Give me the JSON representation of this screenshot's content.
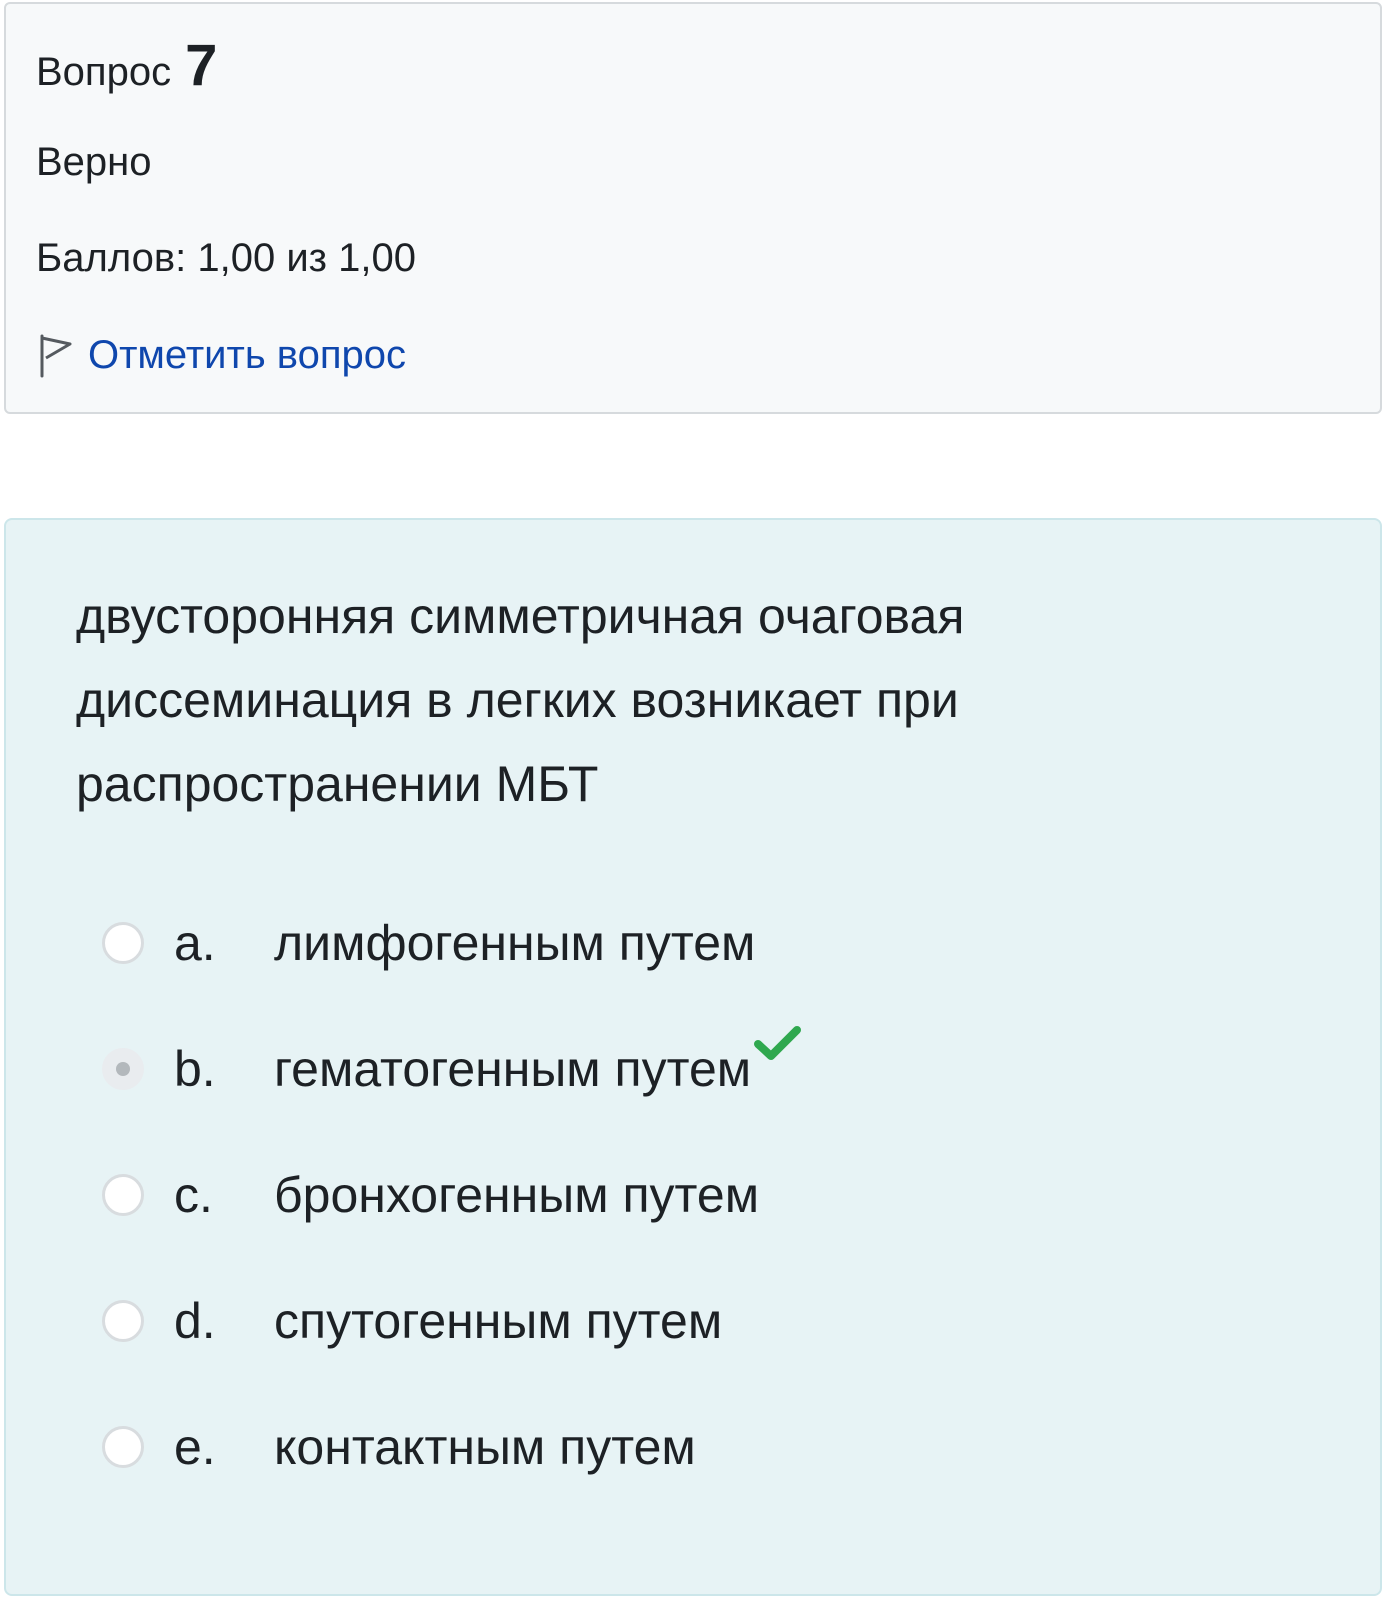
{
  "question_info": {
    "question_word": "Вопрос",
    "question_number": "7",
    "state": "Верно",
    "grade": "Баллов: 1,00 из 1,00",
    "flag_label": "Отметить вопрос"
  },
  "question": {
    "text": "двусторонняя симметричная очаговая диссеминация в легких возникает при распространении МБТ",
    "answers": [
      {
        "letter": "a.",
        "text": "лимфогенным путем",
        "selected": false,
        "correct": false
      },
      {
        "letter": "b.",
        "text": "гематогенным путем",
        "selected": true,
        "correct": true
      },
      {
        "letter": "c.",
        "text": "бронхогенным путем",
        "selected": false,
        "correct": false
      },
      {
        "letter": "d.",
        "text": "спутогенным путем",
        "selected": false,
        "correct": false
      },
      {
        "letter": "e.",
        "text": "контактным путем",
        "selected": false,
        "correct": false
      }
    ]
  },
  "icons": {
    "flag": "flag-icon",
    "correct_mark": "checkmark-icon"
  },
  "colors": {
    "info_background": "#f7f9fa",
    "question_background": "#e7f3f5",
    "link": "#0f47ad",
    "correct_green": "#2fa84f"
  }
}
